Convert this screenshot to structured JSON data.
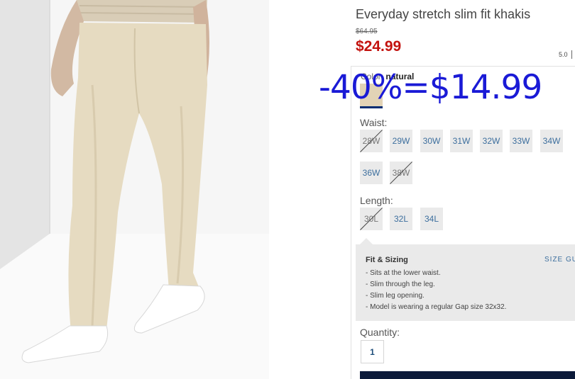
{
  "product": {
    "title": "Everyday stretch slim fit khakis",
    "old_price": "$64.95",
    "sale_price": "$24.99",
    "rating": "5.0"
  },
  "color": {
    "label": "Color:",
    "value": "natural",
    "swatch_hex": "#e2d3b6"
  },
  "overlay_text": "-40%=$14.99",
  "waist": {
    "label": "Waist:",
    "sizes": [
      {
        "label": "28W",
        "available": false
      },
      {
        "label": "29W",
        "available": true
      },
      {
        "label": "30W",
        "available": true
      },
      {
        "label": "31W",
        "available": true
      },
      {
        "label": "32W",
        "available": true
      },
      {
        "label": "33W",
        "available": true
      },
      {
        "label": "34W",
        "available": true
      },
      {
        "label": "36W",
        "available": true
      },
      {
        "label": "38W",
        "available": false
      }
    ]
  },
  "length": {
    "label": "Length:",
    "sizes": [
      {
        "label": "30L",
        "available": false
      },
      {
        "label": "32L",
        "available": true
      },
      {
        "label": "34L",
        "available": true
      }
    ]
  },
  "fit": {
    "title": "Fit & Sizing",
    "guide_label": "SIZE GU",
    "bullets": [
      "- Sits at the lower waist.",
      "- Slim through the leg.",
      "- Slim leg opening.",
      "- Model is wearing a regular Gap size 32x32."
    ]
  },
  "quantity": {
    "label": "Quantity:",
    "value": "1"
  },
  "colors": {
    "sale_red": "#c3130f",
    "link_blue": "#3d6f9e",
    "overlay_blue": "#1a1ad6",
    "navy": "#0c1a3a"
  }
}
